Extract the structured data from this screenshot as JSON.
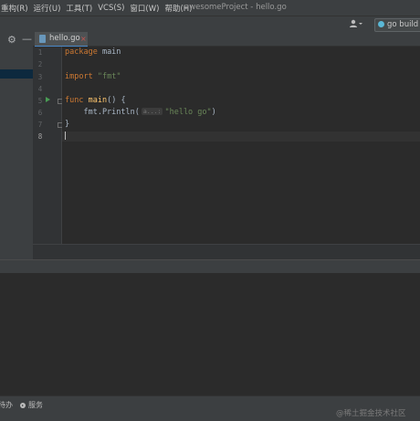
{
  "menubar": {
    "items": [
      "重构(R)",
      "运行(U)",
      "工具(T)",
      "VCS(S)",
      "窗口(W)",
      "帮助(H)"
    ],
    "window_title": "awesomeProject - hello.go"
  },
  "toolbar": {
    "user_icon": "user-icon",
    "run_config_label": "go build"
  },
  "project_panel": {
    "gear_icon": "gear-icon",
    "collapse_icon": "minus-icon"
  },
  "editor": {
    "tab": {
      "label": "hello.go",
      "close_glyph": "×",
      "icon": "go-file-icon"
    },
    "line_numbers": [
      "1",
      "2",
      "3",
      "4",
      "5",
      "6",
      "7",
      "8"
    ],
    "code": {
      "line1_kw": "package",
      "line1_name": " main",
      "line3_kw": "import",
      "line3_str": "\"fmt\"",
      "line5_kw": "func",
      "line5_fn": "main",
      "line5_rest": "() {",
      "line6_call": "    fmt.Println(",
      "line6_hint": "a...:",
      "line6_str": "\"hello go\"",
      "line6_close": ")",
      "line7": "}"
    },
    "gutter_icons": [
      "run-arrow-icon",
      "fold-icon",
      "lightbulb-icon"
    ]
  },
  "statusbar": {
    "todo_label": "待办",
    "services_label": "服务"
  },
  "watermark": "@稀土掘金技术社区",
  "colors": {
    "keyword": "#cc7832",
    "function": "#ffc66d",
    "string": "#6a8759",
    "run_arrow": "#499c54",
    "tab_underline": "#4a88c7"
  }
}
